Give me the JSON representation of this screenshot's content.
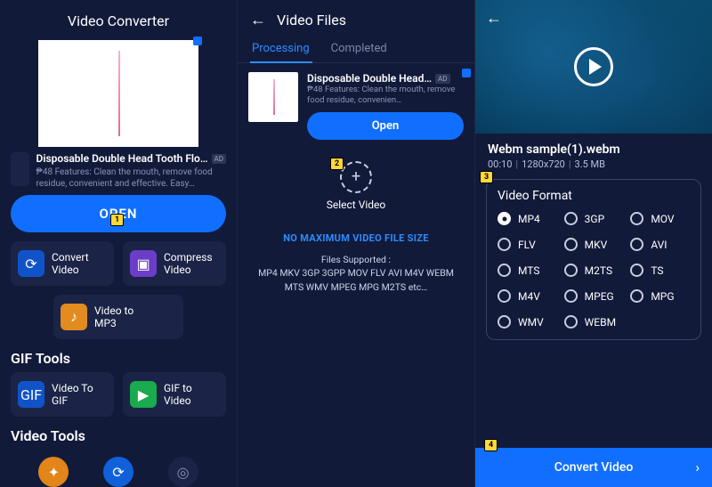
{
  "markers": {
    "m1": "1",
    "m2": "2",
    "m3": "3",
    "m4": "4"
  },
  "panel1": {
    "title": "Video Converter",
    "ad": {
      "title": "Disposable Double Head Tooth Flo…",
      "badge": "AD",
      "subtitle": "₱48 Features: Clean the mouth, remove food residue, convenient and effective. Easy…"
    },
    "open_btn": "OPEN",
    "tools": {
      "convert": "Convert\nVideo",
      "compress": "Compress\nVideo",
      "mp3": "Video to\nMP3"
    },
    "gif_header": "GIF Tools",
    "gif_tools": {
      "to_gif": "Video To\nGIF",
      "to_video": "GIF to\nVideo"
    },
    "video_header": "Video Tools"
  },
  "panel2": {
    "title": "Video Files",
    "tabs": {
      "processing": "Processing",
      "completed": "Completed"
    },
    "ad": {
      "title": "Disposable Double Head…",
      "badge": "AD",
      "subtitle": "₱48 Features: Clean the mouth, remove food residue, convenien…",
      "open": "Open"
    },
    "select_label": "Select Video",
    "no_max": "NO MAXIMUM VIDEO FILE SIZE",
    "files_supported_h": "Files Supported :",
    "files_supported": "MP4 MKV 3GP 3GPP MOV FLV AVI M4V WEBM MTS WMV MPEG MPG M2TS etc…"
  },
  "panel3": {
    "filename": "Webm sample(1).webm",
    "duration": "00:10",
    "resolution": "1280x720",
    "size": "3.5 MB",
    "format_header": "Video Format",
    "formats": [
      "MP4",
      "3GP",
      "MOV",
      "FLV",
      "MKV",
      "AVI",
      "MTS",
      "M2TS",
      "TS",
      "M4V",
      "MPEG",
      "MPG",
      "WMV",
      "WEBM"
    ],
    "selected_format": "MP4",
    "convert_btn": "Convert Video"
  }
}
